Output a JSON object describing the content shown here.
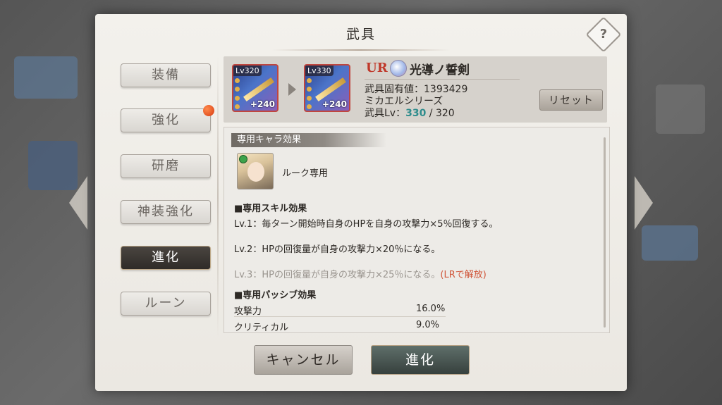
{
  "dialog": {
    "title": "武具"
  },
  "tabs": [
    {
      "label": "装備",
      "active": false,
      "badge": false
    },
    {
      "label": "強化",
      "active": false,
      "badge": true
    },
    {
      "label": "研磨",
      "active": false,
      "badge": false
    },
    {
      "label": "神装強化",
      "active": false,
      "badge": false
    },
    {
      "label": "進化",
      "active": true,
      "badge": false
    },
    {
      "label": "ルーン",
      "active": false,
      "badge": false
    }
  ],
  "weapon": {
    "before": {
      "level": "Lv320",
      "plus": "+240"
    },
    "after": {
      "level": "Lv330",
      "plus": "+240"
    },
    "rarity": "UR",
    "name": "光導ノ誓剣",
    "unique_value_label": "武具固有値：1393429",
    "series": "ミカエルシリーズ",
    "level_label": "武具Lv：",
    "level_current": "330",
    "level_separator": " / ",
    "level_max": "320",
    "reset_label": "リセット"
  },
  "effect": {
    "section_title": "専用キャラ効果",
    "character_label": "ルーク専用",
    "skill_heading": "■専用スキル効果",
    "skills": [
      "Lv.1：毎ターン開始時自身のHPを自身の攻撃力×5％回復する。",
      "Lv.2：HPの回復量が自身の攻撃力×20％になる。",
      "Lv.3：HPの回復量が自身の攻撃力×25％になる。"
    ],
    "lv3_note": "(LRで解放)",
    "passive_heading": "■専用パッシブ効果",
    "passives": [
      {
        "name": "攻撃力",
        "value": "16.0%"
      },
      {
        "name": "クリティカル",
        "value": "9.0%"
      }
    ]
  },
  "buttons": {
    "cancel": "キャンセル",
    "evolve": "進化"
  },
  "colors": {
    "rarity": "#c0392b",
    "level_current": "#2e8c8c",
    "lr_note": "#d0563a",
    "badge_dot": "#e2541c"
  }
}
